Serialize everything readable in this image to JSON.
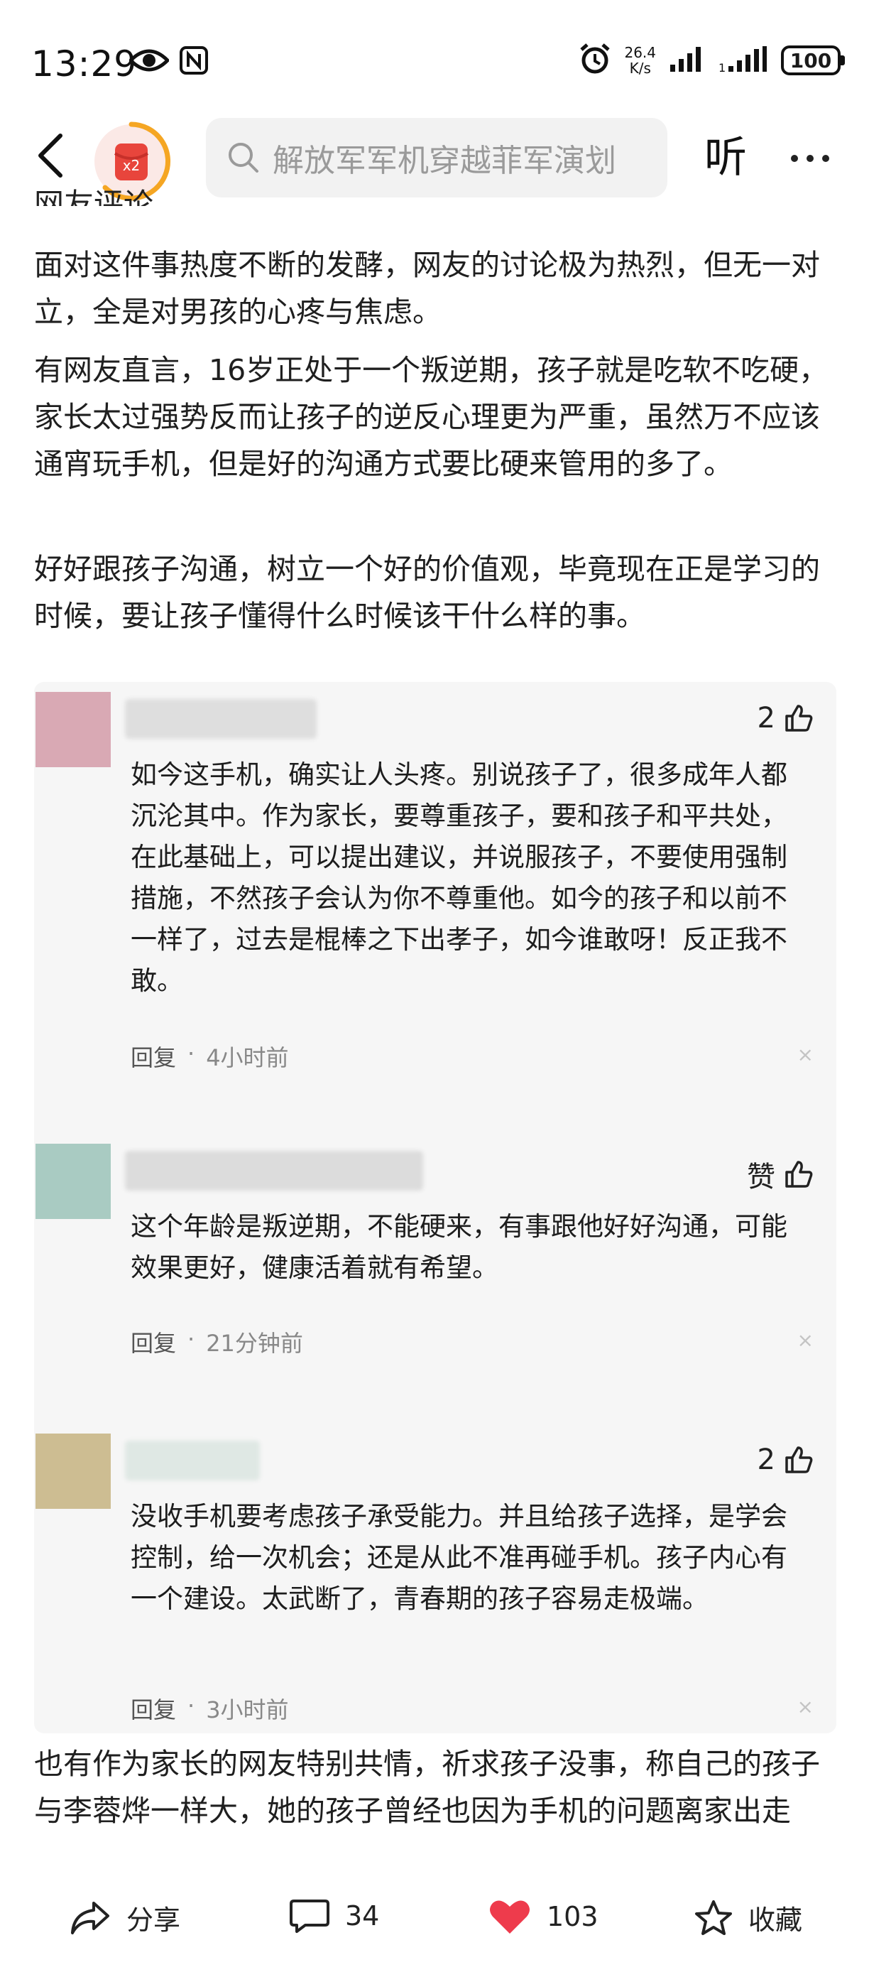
{
  "status_bar": {
    "time": "13:29",
    "net_speed_value": "26.4",
    "net_speed_unit": "K/s",
    "battery": "100"
  },
  "nav": {
    "coin_badge": "x2",
    "search_placeholder": "解放军军机穿越菲军演划",
    "listen_label": "听"
  },
  "article": {
    "clipped_heading": "网友评论",
    "paragraphs": [
      "面对这件事热度不断的发酵，网友的讨论极为热烈，但无一对立，全是对男孩的心疼与焦虑。",
      "有网友直言，16岁正处于一个叛逆期，孩子就是吃软不吃硬，家长太过强势反而让孩子的逆反心理更为严重，虽然万不应该通宵玩手机，但是好的沟通方式要比硬来管用的多了。",
      "好好跟孩子沟通，树立一个好的价值观，毕竟现在正是学习的时候，要让孩子懂得什么时候该干什么样的事。",
      "也有作为家长的网友特别共情，祈求孩子没事，称自己的孩子与李蓉烨一样大，她的孩子曾经也因为手机的问题离家出走过，但是经过好好沟通，双方达成约定，后面就没有发生"
    ]
  },
  "comments": [
    {
      "likes": "2",
      "text": "如今这手机，确实让人头疼。别说孩子了，很多成年人都沉沦其中。作为家长，要尊重孩子，要和孩子和平共处，在此基础上，可以提出建议，并说服孩子，不要使用强制措施，不然孩子会认为你不尊重他。如今的孩子和以前不一样了，过去是棍棒之下出孝子，如今谁敢呀！反正我不敢。",
      "reply": "回复",
      "dot": "·",
      "time": "4小时前",
      "close": "×",
      "avatar_color": "#d9a9b4"
    },
    {
      "likes": "赞",
      "text": "这个年龄是叛逆期，不能硬来，有事跟他好好沟通，可能效果更好，健康活着就有希望。",
      "reply": "回复",
      "dot": "·",
      "time": "21分钟前",
      "close": "×",
      "avatar_color": "#a9cbc2"
    },
    {
      "likes": "2",
      "text": "没收手机要考虑孩子承受能力。并且给孩子选择，是学会控制，给一次机会；还是从此不准再碰手机。孩子内心有一个建设。太武断了，青春期的孩子容易走极端。",
      "reply": "回复",
      "dot": "·",
      "time": "3小时前",
      "close": "×",
      "avatar_color": "#cdbd92"
    }
  ],
  "bottom_bar": {
    "share": "分享",
    "comments": "34",
    "likes": "103",
    "favorite": "收藏"
  },
  "colors": {
    "like_heart": "#ee3b4c",
    "coin_red": "#e8453c",
    "coin_ring": "#f5a623"
  }
}
